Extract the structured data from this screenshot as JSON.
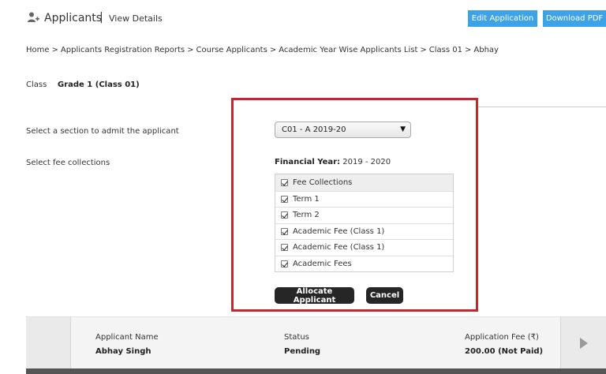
{
  "header": {
    "title": "Applicants",
    "separator": "|",
    "subtitle": "View Details",
    "edit_button": "Edit Application",
    "pdf_button": "Download PDF"
  },
  "breadcrumb": {
    "items": [
      "Home",
      "Applicants Registration Reports",
      "Course Applicants",
      "Academic Year Wise Applicants List",
      "Class 01",
      "Abhay"
    ],
    "separator": ">"
  },
  "class_info": {
    "label": "Class",
    "value": "Grade 1 (Class 01)"
  },
  "form": {
    "section_label": "Select a section to admit the applicant",
    "fee_label": "Select fee collections"
  },
  "modal": {
    "section_select": {
      "selected": "C01 - A 2019-20",
      "caret": "▼"
    },
    "financial_year_label": "Financial Year:",
    "financial_year_value": "2019 - 2020",
    "fee_rows": [
      {
        "label": "Fee Collections",
        "checked": true
      },
      {
        "label": "Term 1",
        "checked": true
      },
      {
        "label": "Term 2",
        "checked": true
      },
      {
        "label": "Academic Fee (Class 1)",
        "checked": true
      },
      {
        "label": "Academic Fee (Class 1)",
        "checked": true
      },
      {
        "label": "Academic Fees",
        "checked": true
      }
    ],
    "allocate_button": "Allocate Applicant",
    "cancel_button": "Cancel",
    "border_color": "#c0282e"
  },
  "applicant_card": {
    "name_label": "Applicant Name",
    "name_value": "Abhay Singh",
    "status_label": "Status",
    "status_value": "Pending",
    "fee_label": "Application Fee (₹)",
    "fee_value": "200.00 (Not Paid)"
  },
  "colors": {
    "accent": "#3ea3e6",
    "dark_button": "#262626"
  }
}
